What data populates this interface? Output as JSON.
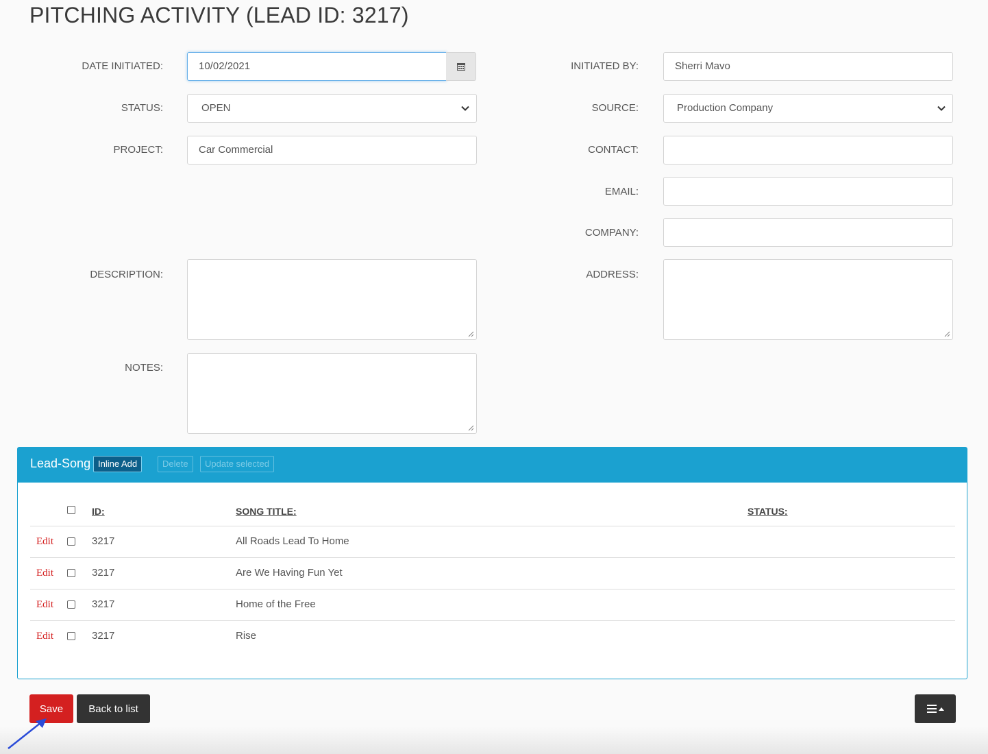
{
  "page": {
    "title": "PITCHING ACTIVITY (LEAD ID: 3217)"
  },
  "form": {
    "date_initiated": {
      "label": "DATE INITIATED:",
      "value": "10/02/2021"
    },
    "status": {
      "label": "STATUS:",
      "value": "OPEN"
    },
    "project": {
      "label": "PROJECT:",
      "value": "Car Commercial"
    },
    "description": {
      "label": "DESCRIPTION:",
      "value": ""
    },
    "notes": {
      "label": "NOTES:",
      "value": ""
    },
    "initiated_by": {
      "label": "INITIATED BY:",
      "value": "Sherri Mavo"
    },
    "source": {
      "label": "SOURCE:",
      "value": "Production Company"
    },
    "contact": {
      "label": "CONTACT:",
      "value": ""
    },
    "email": {
      "label": "EMAIL:",
      "value": ""
    },
    "company": {
      "label": "COMPANY:",
      "value": ""
    },
    "address": {
      "label": "ADDRESS:",
      "value": ""
    }
  },
  "panel": {
    "title": "Lead-Song",
    "inline_add": "Inline Add",
    "delete": "Delete",
    "update_selected": "Update selected",
    "columns": {
      "id": "ID:",
      "song_title": "SONG TITLE:",
      "status": "STATUS:"
    },
    "edit_label": "Edit",
    "rows": [
      {
        "id": "3217",
        "title": "All Roads Lead To Home",
        "status": ""
      },
      {
        "id": "3217",
        "title": "Are We Having Fun Yet",
        "status": ""
      },
      {
        "id": "3217",
        "title": "Home of the Free",
        "status": ""
      },
      {
        "id": "3217",
        "title": "Rise",
        "status": ""
      }
    ]
  },
  "footer": {
    "save": "Save",
    "back": "Back to list"
  },
  "colors": {
    "accent": "#1ba1d0",
    "save": "#d42020",
    "dark": "#333333",
    "edit_link": "#d42020",
    "annotation_arrow": "#2a4bd8"
  },
  "icons": {
    "calendar": "calendar-icon",
    "chevron": "chevron-down-icon",
    "menu": "hamburger-menu-icon",
    "caret": "caret-up-icon",
    "arrow": "annotation-arrow-icon"
  }
}
